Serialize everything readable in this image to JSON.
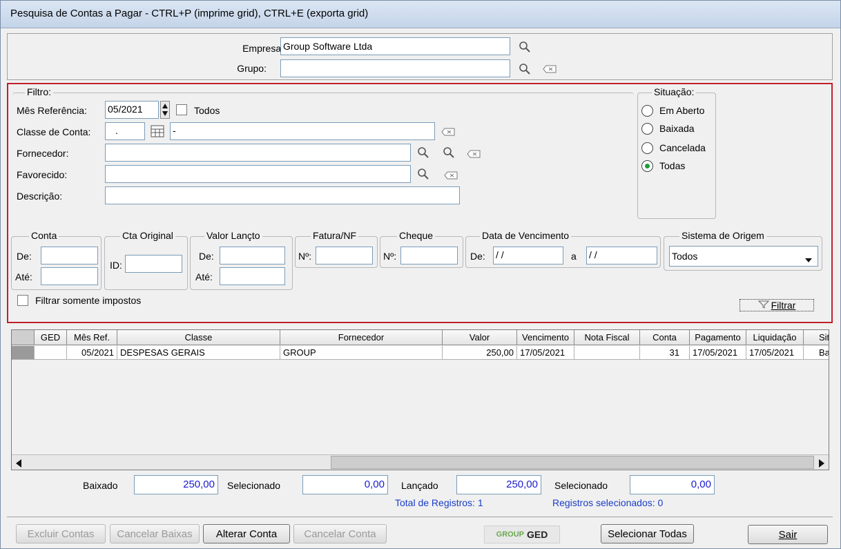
{
  "window": {
    "title": "Pesquisa de Contas a Pagar - CTRL+P (imprime grid), CTRL+E (exporta grid)"
  },
  "top": {
    "empresa_label": "Empresa:",
    "empresa_value": "Group Software Ltda",
    "grupo_label": "Grupo:",
    "grupo_value": ""
  },
  "filtro": {
    "title": "Filtro:",
    "mes_ref_label": "Mês Referência:",
    "mes_ref_value": "05/2021",
    "todos_label": "Todos",
    "classe_label": "Classe de Conta:",
    "classe_code": ".",
    "classe_desc": "-",
    "fornecedor_label": "Fornecedor:",
    "favorecido_label": "Favorecido:",
    "descricao_label": "Descrição:"
  },
  "situacao": {
    "title": "Situação:",
    "options": [
      "Em Aberto",
      "Baixada",
      "Cancelada",
      "Todas"
    ],
    "selected": "Todas"
  },
  "groups": {
    "conta": {
      "title": "Conta",
      "de": "De:",
      "ate": "Até:"
    },
    "cta_original": {
      "title": "Cta Original",
      "id": "ID:"
    },
    "valor_lancto": {
      "title": "Valor Lançto",
      "de": "De:",
      "ate": "Até:"
    },
    "fatura": {
      "title": "Fatura/NF",
      "no": "Nº:"
    },
    "cheque": {
      "title": "Cheque",
      "no": "Nº:"
    },
    "vencimento": {
      "title": "Data de Vencimento",
      "de": "De:",
      "a": "a",
      "de_value": " /  /",
      "a_value": " /  /"
    },
    "sistema": {
      "title": "Sistema de Origem",
      "value": "Todos"
    }
  },
  "filtrar_impostos_label": "Filtrar somente impostos",
  "filtrar_button": "Filtrar",
  "grid": {
    "columns": [
      "GED",
      "Mês Ref.",
      "Classe",
      "Fornecedor",
      "Valor",
      "Vencimento",
      "Nota Fiscal",
      "Conta",
      "Pagamento",
      "Liquidação",
      "Sit"
    ],
    "rows": [
      [
        "",
        "05/2021",
        "DESPESAS GERAIS",
        "GROUP",
        "250,00",
        "17/05/2021",
        "",
        "31",
        "17/05/2021",
        "17/05/2021",
        "Ba"
      ]
    ]
  },
  "totals": {
    "baixado_label": "Baixado",
    "baixado_value": "250,00",
    "selecionado1_label": "Selecionado",
    "selecionado1_value": "0,00",
    "lancado_label": "Lançado",
    "lancado_value": "250,00",
    "selecionado2_label": "Selecionado",
    "selecionado2_value": "0,00",
    "total_registros": "Total de Registros: 1",
    "registros_selecionados": "Registros selecionados: 0"
  },
  "buttons": {
    "excluir": "Excluir Contas",
    "cancelar_baixas": "Cancelar Baixas",
    "alterar": "Alterar Conta",
    "cancelar_conta": "Cancelar Conta",
    "selecionar_todas": "Selecionar Todas",
    "sair": "Sair"
  },
  "logo": {
    "group": "GROUP",
    "ged": "GED"
  },
  "colors": {
    "accent_border": "#c0202a",
    "value_blue": "#1a1ad0",
    "radio_green": "#1d9d3a"
  }
}
